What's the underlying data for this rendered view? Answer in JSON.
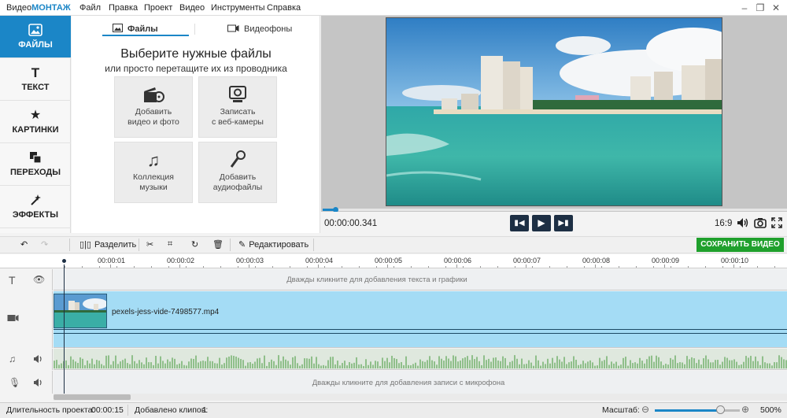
{
  "app": {
    "title_prefix": "Видео",
    "title_brand": "МОНТАЖ"
  },
  "menu": [
    "Файл",
    "Правка",
    "Проект",
    "Видео",
    "Инструменты",
    "Справка"
  ],
  "sidebar": {
    "items": [
      {
        "label": "ФАЙЛЫ",
        "icon": "image-icon",
        "active": true
      },
      {
        "label": "ТЕКСТ",
        "icon": "text-t-icon"
      },
      {
        "label": "КАРТИНКИ",
        "icon": "star-icon"
      },
      {
        "label": "ПЕРЕХОДЫ",
        "icon": "transitions-icon"
      },
      {
        "label": "ЭФФЕКТЫ",
        "icon": "magic-wand-icon"
      }
    ]
  },
  "files_panel": {
    "tabs": [
      {
        "label": "Файлы",
        "icon": "image-icon",
        "active": true
      },
      {
        "label": "Видеофоны",
        "icon": "film-icon"
      }
    ],
    "heading": "Выберите нужные файлы",
    "subheading": "или просто перетащите их из проводника",
    "tiles": [
      {
        "line1": "Добавить",
        "line2": "видео и фото",
        "icon": "film-reel-icon"
      },
      {
        "line1": "Записать",
        "line2": "с веб-камеры",
        "icon": "webcam-icon"
      },
      {
        "line1": "Коллекция",
        "line2": "музыки",
        "icon": "music-notes-icon"
      },
      {
        "line1": "Добавить",
        "line2": "аудиофайлы",
        "icon": "microphone-icon"
      }
    ]
  },
  "player": {
    "timecode": "00:00:00.341",
    "progress": 0.01,
    "aspect_ratio": "16:9"
  },
  "toolbar": {
    "split_label": "Разделить",
    "edit_label": "Редактировать",
    "save_label": "СОХРАНИТЬ ВИДЕО"
  },
  "ruler": {
    "ticks": [
      "00:00:01",
      "00:00:02",
      "00:00:03",
      "00:00:04",
      "00:00:05",
      "00:00:06",
      "00:00:07",
      "00:00:08",
      "00:00:09",
      "00:00:10"
    ]
  },
  "timeline": {
    "text_hint": "Дважды кликните для добавления текста и графики",
    "clip_name": "pexels-jess-vide-7498577.mp4",
    "mic_hint": "Дважды кликните для добавления записи с микрофона"
  },
  "status": {
    "duration_label": "Длительность проекта:",
    "duration_value": "00:00:15",
    "clips_label": "Добавлено клипов:",
    "clips_value": "1",
    "zoom_label": "Масштаб:",
    "zoom_value": "500%",
    "zoom_level": 0.78
  },
  "colors": {
    "accent": "#1b86c7",
    "save_green": "#1fa02c",
    "video_track": "#a4dcf5",
    "audio_wave": "#8fbf8a"
  }
}
